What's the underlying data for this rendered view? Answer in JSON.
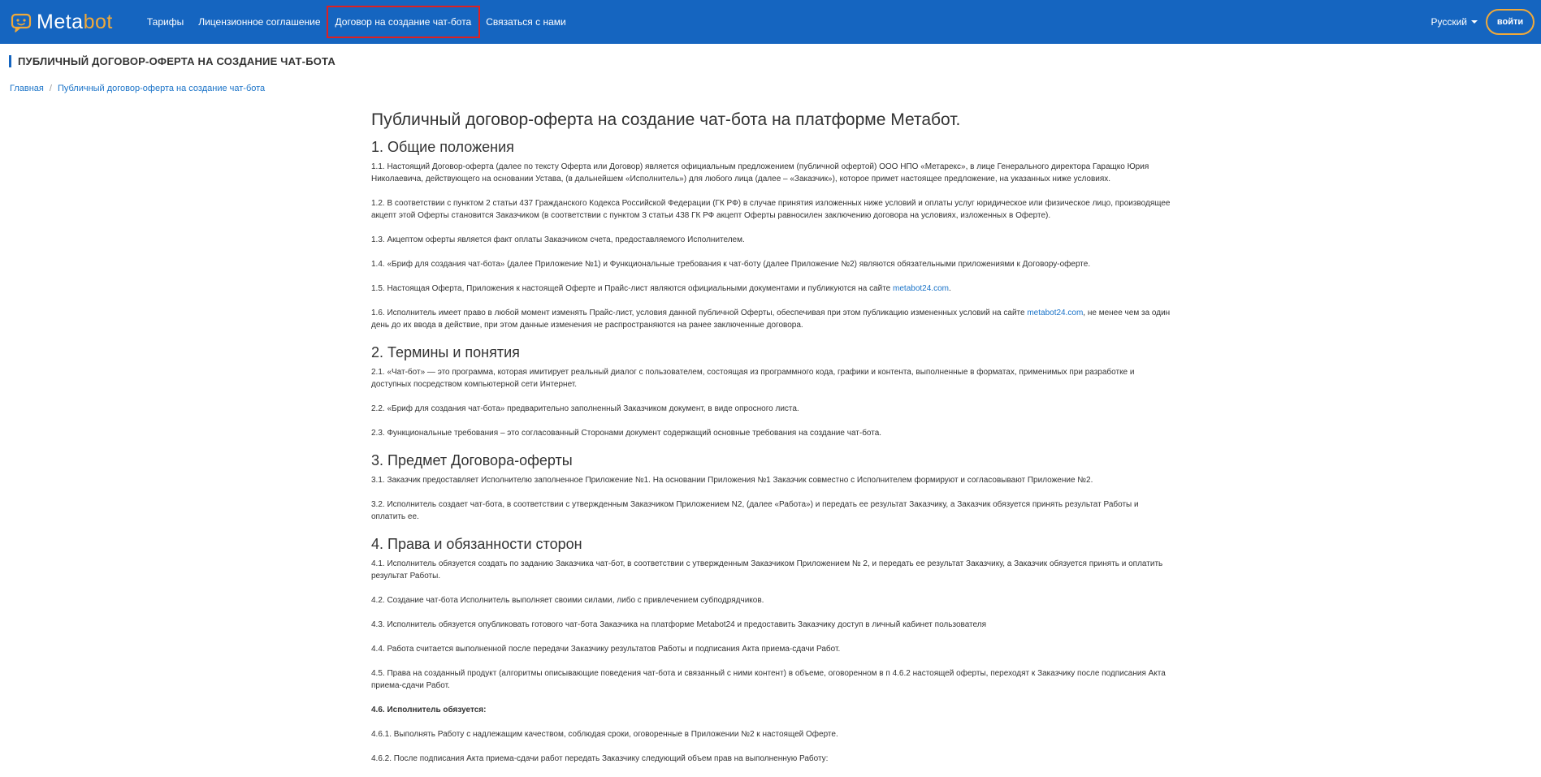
{
  "nav": {
    "logo_main": "Meta",
    "logo_accent": "bot",
    "links": [
      "Тарифы",
      "Лицензионное соглашение",
      "Договор на создание чат-бота",
      "Связаться с нами"
    ],
    "language": "Русский",
    "login": "войти",
    "colors": {
      "bar": "#1565c0",
      "accent": "#f0a93a",
      "highlight": "#e02020"
    }
  },
  "page_title": "ПУБЛИЧНЫЙ ДОГОВОР-ОФЕРТА НА СОЗДАНИЕ ЧАТ-БОТА",
  "breadcrumb": {
    "home": "Главная",
    "current": "Публичный договор-оферта на создание чат-бота"
  },
  "doc": {
    "title": "Публичный договор-оферта на создание чат-бота на платформе Метабот.",
    "s1": {
      "heading": "1. Общие положения",
      "p1": "1.1. Настоящий Договор-оферта (далее по тексту Оферта или Договор) является официальным предложением (публичной офертой) ООО НПО «Метарекс», в лице Генерального директора Гаращко Юрия Николаевича, действующего на основании Устава, (в дальнейшем «Исполнитель») для любого лица (далее – «Заказчик»), которое примет настоящее предложение, на указанных ниже условиях.",
      "p2": "1.2. В соответствии с пунктом 2 статьи 437 Гражданского Кодекса Российской Федерации (ГК РФ) в случае принятия изложенных ниже условий и оплаты услуг юридическое или физическое лицо, производящее акцепт этой Оферты становится Заказчиком (в соответствии с пунктом 3 статьи 438 ГК РФ акцепт Оферты равносилен заключению договора на условиях, изложенных в Оферте).",
      "p3": "1.3. Акцептом оферты является факт оплаты Заказчиком счета, предоставляемого Исполнителем.",
      "p4": "1.4. «Бриф для создания чат-бота» (далее Приложение №1) и Функциональные требования к чат-боту (далее Приложение №2) являются обязательными приложениями к Договору-оферте.",
      "p5_a": "1.5. Настоящая Оферта, Приложения к настоящей Оферте и Прайс-лист являются официальными документами и публикуются на сайте ",
      "p5_link": "metabot24.com",
      "p5_b": ".",
      "p6_a": "1.6. Исполнитель имеет право в любой момент изменять Прайс-лист, условия данной публичной Оферты, обеспечивая при этом публикацию измененных условий на сайте ",
      "p6_link": "metabot24.com",
      "p6_b": ", не менее чем за один день до их ввода в действие, при этом данные изменения не распространяются на ранее заключенные договора."
    },
    "s2": {
      "heading": "2. Термины и понятия",
      "p1": "2.1. «Чат-бот» — это программа, которая имитирует реальный диалог с пользователем, состоящая из программного кода, графики и контента, выполненные в форматах, применимых при разработке и доступных посредством компьютерной сети Интернет.",
      "p2": "2.2. «Бриф для создания чат-бота» предварительно заполненный Заказчиком документ, в виде опросного листа.",
      "p3": "2.3. Функциональные требования – это согласованный Сторонами документ содержащий основные требования на создание чат-бота."
    },
    "s3": {
      "heading": "3. Предмет Договора-оферты",
      "p1": "3.1. Заказчик предоставляет Исполнителю заполненное Приложение №1. На основании Приложения №1 Заказчик совместно с Исполнителем формируют и согласовывают Приложение №2.",
      "p2": "3.2. Исполнитель создает чат-бота, в соответствии с утвержденным Заказчиком Приложением N2, (далее «Работа») и передать ее результат Заказчику, а Заказчик обязуется принять результат Работы и оплатить ее."
    },
    "s4": {
      "heading": "4. Права и обязанности сторон",
      "p1": "4.1. Исполнитель обязуется создать по заданию Заказчика чат-бот, в соответствии с утвержденным Заказчиком Приложением № 2, и передать ее результат Заказчику, а Заказчик обязуется принять и оплатить результат Работы.",
      "p2": "4.2. Создание чат-бота Исполнитель выполняет своими силами, либо с привлечением субподрядчиков.",
      "p3": "4.3. Исполнитель обязуется опубликовать готового чат-бота Заказчика на платформе Metabot24 и предоставить Заказчику доступ в личный кабинет пользователя",
      "p4": "4.4. Работа считается выполненной после передачи Заказчику результатов Работы и подписания Акта приема-сдачи Работ.",
      "p5": "4.5. Права на созданный продукт (алгоритмы описывающие поведения чат-бота и связанный с ними контент) в объеме, оговоренном в п 4.6.2 настоящей оферты, переходят к Заказчику после подписания Акта приема-сдачи Работ.",
      "p6": "4.6. Исполнитель обязуется:",
      "p7": "4.6.1. Выполнять Работу с надлежащим качеством, соблюдая сроки, оговоренные в Приложении №2 к настоящей Оферте.",
      "p8": "4.6.2. После подписания Акта приема-сдачи работ передать Заказчику следующий объем прав на выполненную Работу:"
    }
  }
}
